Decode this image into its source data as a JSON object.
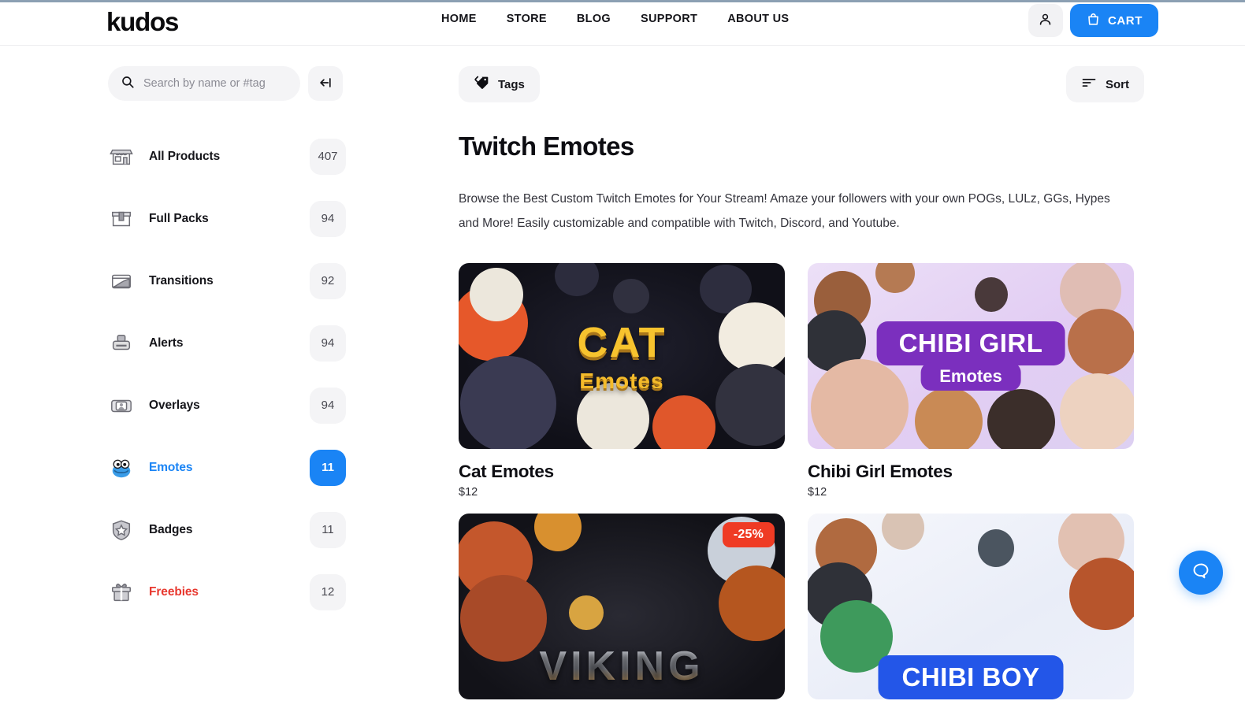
{
  "header": {
    "logo": "kudos",
    "nav": [
      {
        "label": "HOME"
      },
      {
        "label": "STORE"
      },
      {
        "label": "BLOG"
      },
      {
        "label": "SUPPORT"
      },
      {
        "label": "ABOUT US"
      }
    ],
    "account_icon": "user-icon",
    "cart_label": "CART",
    "cart_icon": "shopping-bag-icon",
    "cart_color": "#1a84f5"
  },
  "sidebar": {
    "search": {
      "placeholder": "Search by name or #tag",
      "value": "",
      "icon": "search-icon"
    },
    "collapse_icon": "collapse-left-icon",
    "items": [
      {
        "label": "All Products",
        "count": "407",
        "icon": "store-icon",
        "state": "default"
      },
      {
        "label": "Full Packs",
        "count": "94",
        "icon": "box-icon",
        "state": "default"
      },
      {
        "label": "Transitions",
        "count": "92",
        "icon": "transition-icon",
        "state": "default"
      },
      {
        "label": "Alerts",
        "count": "94",
        "icon": "alert-icon",
        "state": "default"
      },
      {
        "label": "Overlays",
        "count": "94",
        "icon": "overlay-icon",
        "state": "default"
      },
      {
        "label": "Emotes",
        "count": "11",
        "icon": "emote-frog-icon",
        "state": "active"
      },
      {
        "label": "Badges",
        "count": "11",
        "icon": "shield-star-icon",
        "state": "default"
      },
      {
        "label": "Freebies",
        "count": "12",
        "icon": "gift-icon",
        "state": "highlight"
      }
    ],
    "active_color": "#1a84f5",
    "highlight_color": "#e8382f"
  },
  "main": {
    "tags_button": "Tags",
    "tags_icon": "tag-icon",
    "sort_button": "Sort",
    "sort_icon": "sort-descending-icon",
    "title": "Twitch Emotes",
    "description": "Browse the Best Custom Twitch Emotes for Your Stream! Amaze your followers with your own POGs, LULz, GGs, Hypes and More! Easily customizable and compatible with Twitch, Discord, and Youtube.",
    "products": [
      {
        "title": "Cat Emotes",
        "price": "$12",
        "art_style": "art-cat",
        "wordmark_main": "CAT",
        "wordmark_sub": "Emotes",
        "badge": ""
      },
      {
        "title": "Chibi Girl Emotes",
        "price": "$12",
        "art_style": "art-chibigirl",
        "wordmark_main": "CHIBI GIRL",
        "wordmark_sub": "Emotes",
        "badge": ""
      },
      {
        "title": "",
        "price": "",
        "art_style": "art-viking",
        "wordmark_main": "VIKING",
        "wordmark_sub": "",
        "badge": "-25%"
      },
      {
        "title": "",
        "price": "",
        "art_style": "art-chibiboy",
        "wordmark_main": "CHIBI BOY",
        "wordmark_sub": "",
        "badge": ""
      }
    ]
  },
  "chat_widget": {
    "icon": "chat-bubble-icon",
    "color": "#1a84f5"
  }
}
